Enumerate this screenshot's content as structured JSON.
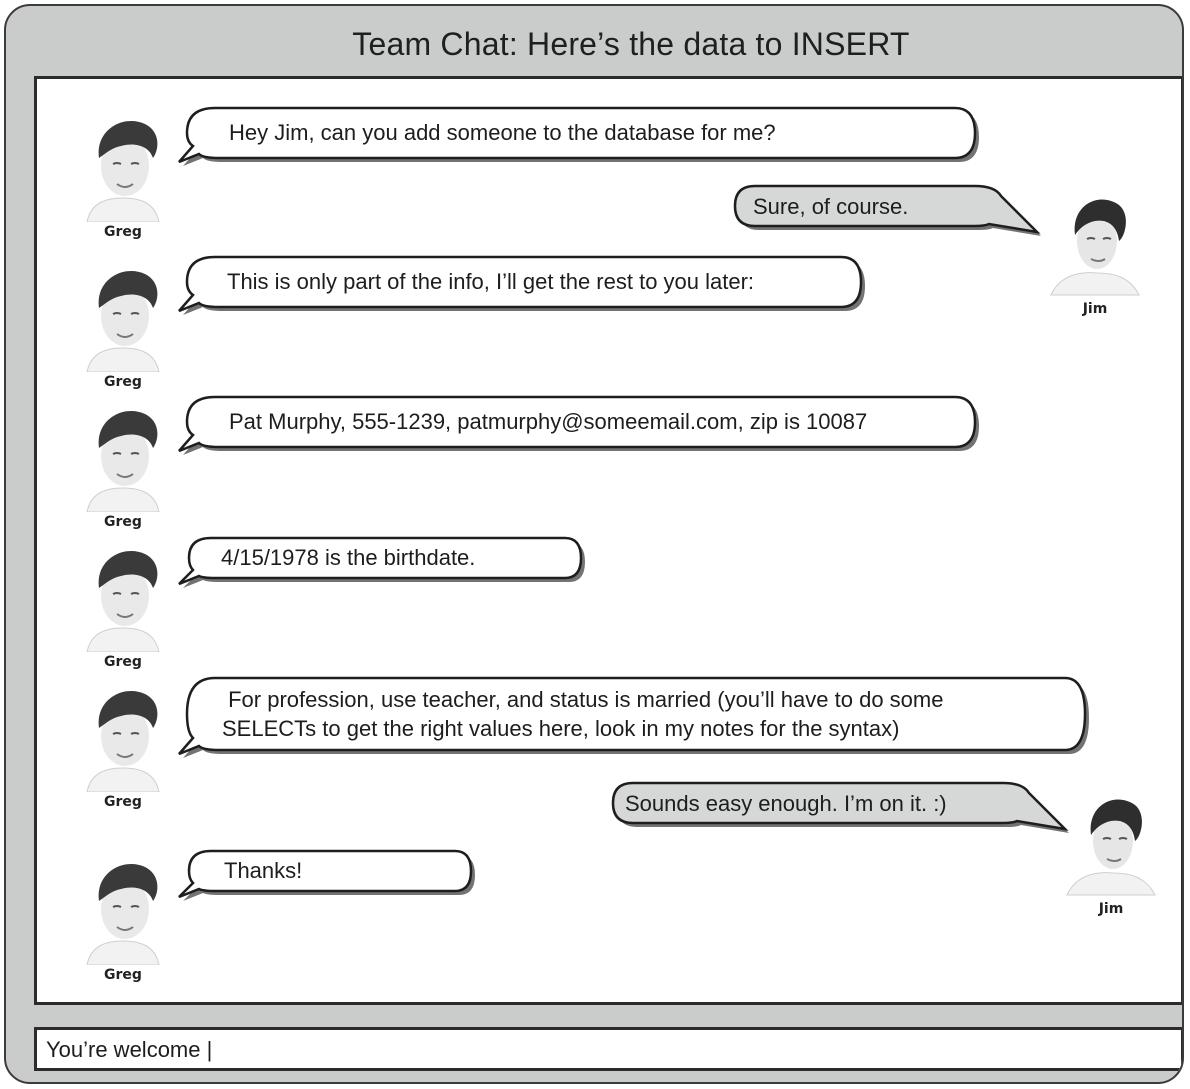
{
  "window": {
    "title": "Team Chat: Here’s the data to INSERT"
  },
  "participants": {
    "greg": {
      "name": "Greg"
    },
    "jim": {
      "name": "Jim"
    }
  },
  "messages": [
    {
      "sender": "Greg",
      "text": "Hey Jim, can you add someone to the database for me?"
    },
    {
      "sender": "Jim",
      "text": "Sure, of course."
    },
    {
      "sender": "Greg",
      "text": "This is only part of the info, I’ll get the rest to you later:"
    },
    {
      "sender": "Greg",
      "text": "Pat Murphy, 555-1239, patmurphy@someemail.com, zip is 10087"
    },
    {
      "sender": "Greg",
      "text": "4/15/1978 is the birthdate."
    },
    {
      "sender": "Greg",
      "text": " For profession, use teacher, and status is married (you’ll have to do some\nSELECTs to get the right values here, look in my notes for the syntax)"
    },
    {
      "sender": "Jim",
      "text": "Sounds easy enough. I’m on it. :)"
    },
    {
      "sender": "Greg",
      "text": "Thanks!"
    }
  ],
  "input": {
    "value": "You’re welcome |"
  },
  "colors": {
    "window_bg": "#cacccb",
    "incoming_bubble": "#ffffff",
    "outgoing_bubble": "#d6d8d7",
    "border": "#2b2b2b"
  },
  "icons": {
    "greg_avatar": "greg-avatar-photo",
    "jim_avatar": "jim-avatar-photo"
  }
}
